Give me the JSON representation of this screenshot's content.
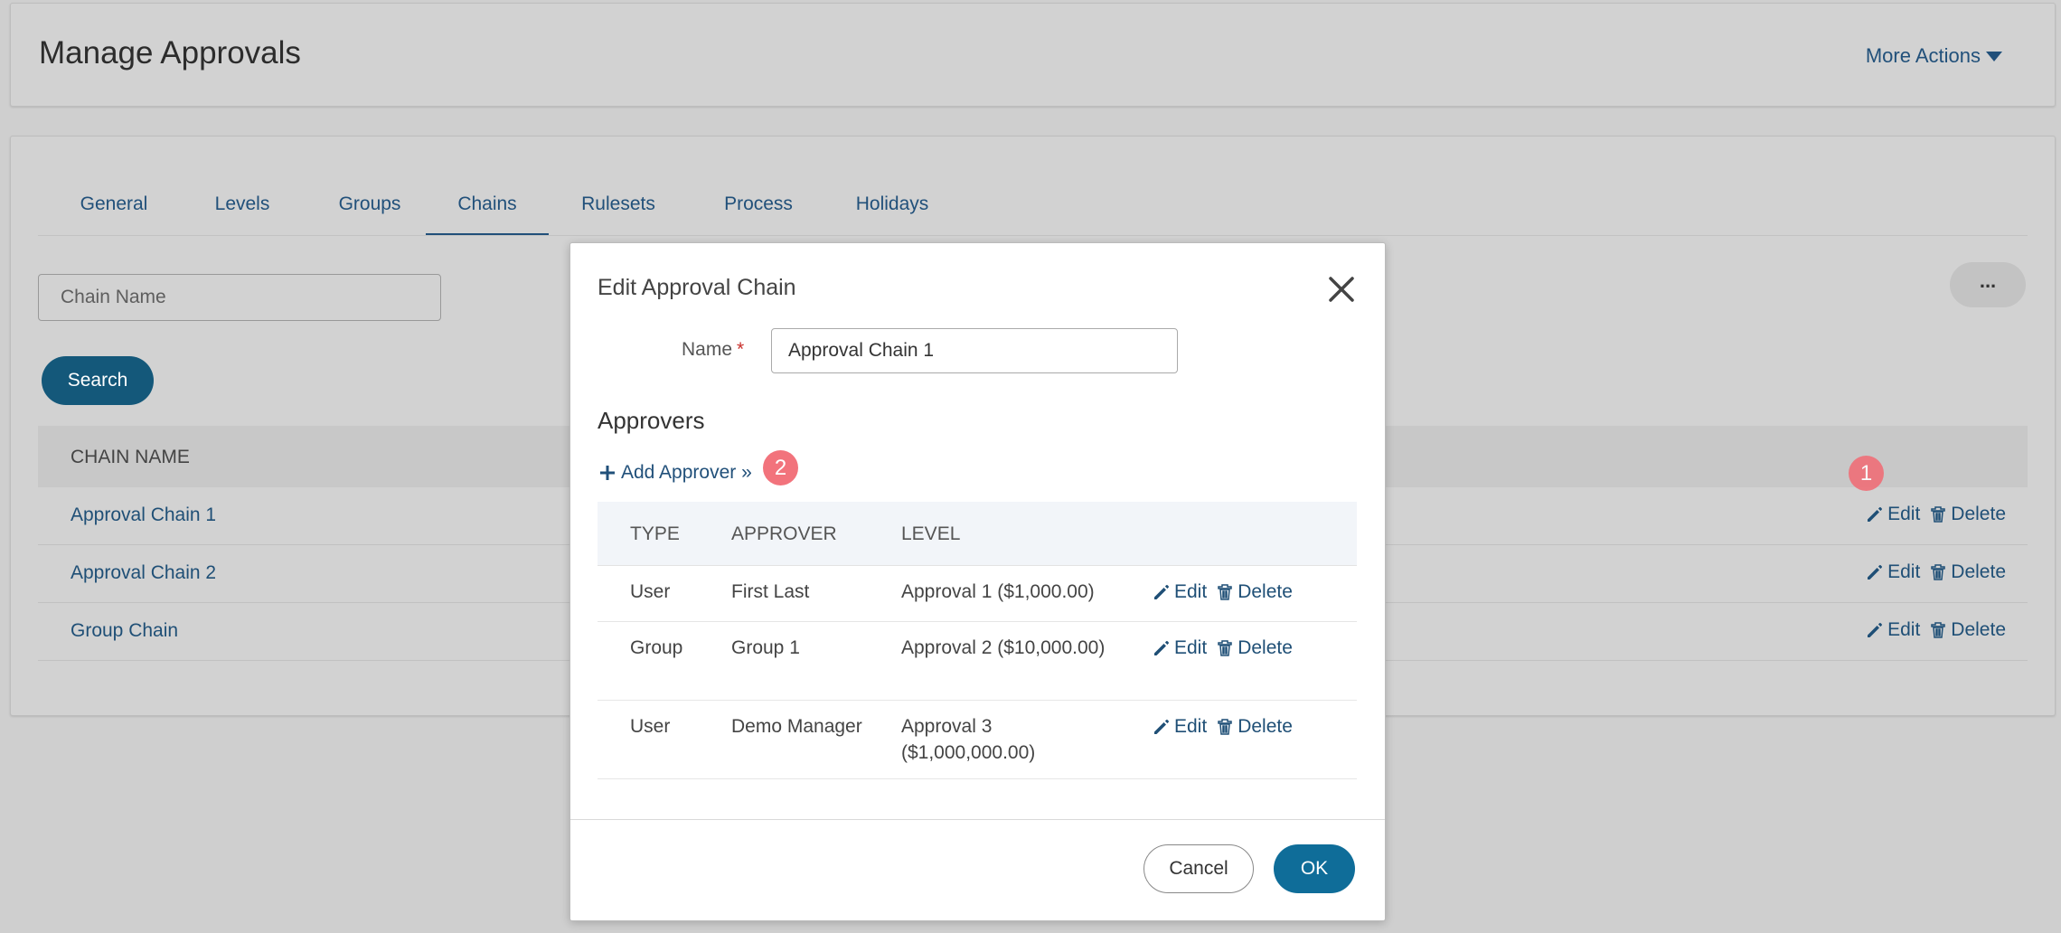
{
  "header": {
    "title": "Manage Approvals",
    "more_actions": "More Actions"
  },
  "tabs": [
    {
      "label": "General"
    },
    {
      "label": "Levels"
    },
    {
      "label": "Groups"
    },
    {
      "label": "Chains",
      "active": true
    },
    {
      "label": "Rulesets"
    },
    {
      "label": "Process"
    },
    {
      "label": "Holidays"
    }
  ],
  "search": {
    "placeholder": "Chain Name",
    "button": "Search"
  },
  "more_menu_label": "...",
  "list": {
    "column_header": "CHAIN NAME",
    "rows": [
      {
        "name": "Approval Chain 1"
      },
      {
        "name": "Approval Chain 2"
      },
      {
        "name": "Group Chain"
      }
    ],
    "edit_label": "Edit",
    "delete_label": "Delete"
  },
  "badges": {
    "one": "1",
    "two": "2"
  },
  "modal": {
    "title": "Edit Approval Chain",
    "name_label": "Name",
    "required_mark": "*",
    "name_value": "Approval Chain 1",
    "approvers_title": "Approvers",
    "add_approver": "Add Approver »",
    "table_headers": {
      "type": "TYPE",
      "approver": "APPROVER",
      "level": "LEVEL"
    },
    "approvers": [
      {
        "type": "User",
        "approver": "First Last",
        "level": "Approval 1 ($1,000.00)"
      },
      {
        "type": "Group",
        "approver": "Group 1",
        "level": "Approval 2 ($10,000.00)"
      },
      {
        "type": "User",
        "approver": "Demo Manager",
        "level": "Approval 3 ($1,000,000.00)"
      }
    ],
    "edit_label": "Edit",
    "delete_label": "Delete",
    "cancel": "Cancel",
    "ok": "OK"
  },
  "colors": {
    "accent": "#14587a",
    "link": "#21507a",
    "badge": "#ef6f78",
    "required": "#c9302c"
  },
  "icons": {
    "edit": "pencil-icon",
    "delete": "trash-icon",
    "add": "plus-icon",
    "close": "close-icon",
    "dropdown": "caret-down-icon"
  }
}
